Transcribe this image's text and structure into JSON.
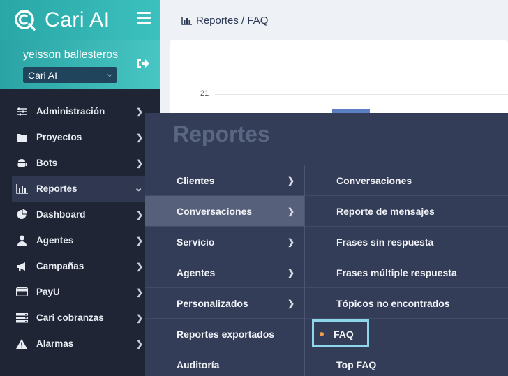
{
  "brand": {
    "name": "Cari AI"
  },
  "user": {
    "name": "yeisson ballesteros",
    "org": "Cari AI"
  },
  "nav": [
    {
      "label": "Administración",
      "icon": "sliders-icon"
    },
    {
      "label": "Proyectos",
      "icon": "folder-icon"
    },
    {
      "label": "Bots",
      "icon": "android-icon"
    },
    {
      "label": "Reportes",
      "icon": "bar-chart-icon",
      "active": true
    },
    {
      "label": "Dashboard",
      "icon": "pie-chart-icon"
    },
    {
      "label": "Agentes",
      "icon": "user-icon"
    },
    {
      "label": "Campañas",
      "icon": "megaphone-icon"
    },
    {
      "label": "PayU",
      "icon": "card-icon"
    },
    {
      "label": "Cari cobranzas",
      "icon": "server-icon"
    },
    {
      "label": "Alarmas",
      "icon": "warning-icon"
    }
  ],
  "breadcrumb": "Reportes / FAQ",
  "chart": {
    "ytick": "21"
  },
  "mega": {
    "title": "Reportes",
    "left": [
      {
        "label": "Clientes",
        "arrow": true
      },
      {
        "label": "Conversaciones",
        "arrow": true,
        "highlight": true
      },
      {
        "label": "Servicio",
        "arrow": true
      },
      {
        "label": "Agentes",
        "arrow": true
      },
      {
        "label": "Personalizados",
        "arrow": true
      },
      {
        "label": "Reportes exportados",
        "arrow": false
      },
      {
        "label": "Auditoría",
        "arrow": false
      }
    ],
    "right": [
      {
        "label": "Conversaciones"
      },
      {
        "label": "Reporte de mensajes"
      },
      {
        "label": "Frases sin respuesta"
      },
      {
        "label": "Frases múltiple respuesta"
      },
      {
        "label": "Tópicos no encontrados"
      },
      {
        "label": "FAQ",
        "selected": true
      },
      {
        "label": "Top FAQ"
      }
    ]
  },
  "colors": {
    "accent": "#2aa3a4",
    "sidebar": "#1f2535",
    "menu": "#333d57",
    "selected_border": "#8fd6ea",
    "dot": "#f09a4c"
  }
}
